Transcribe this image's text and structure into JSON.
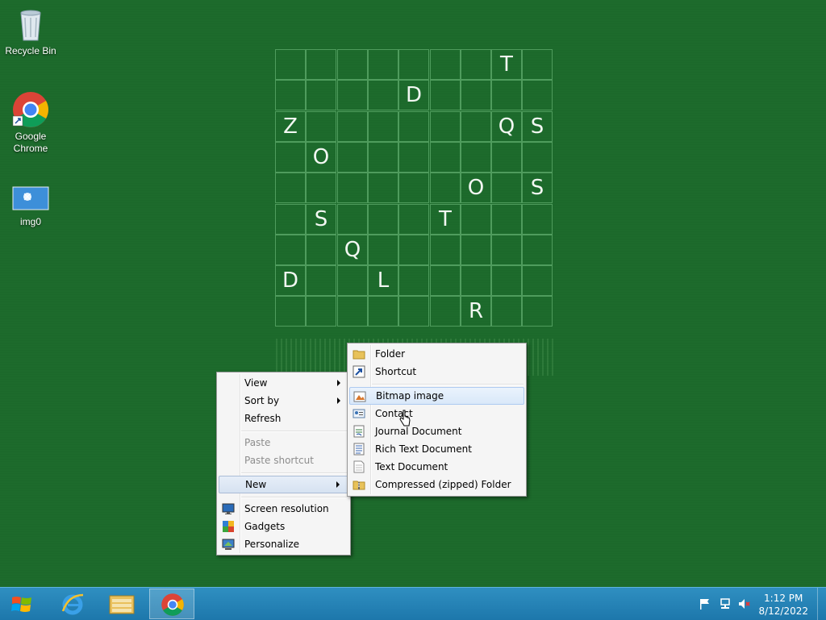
{
  "desktop": {
    "icons": [
      {
        "label": "Recycle Bin",
        "icon": "recycle-bin-icon"
      },
      {
        "label": "Google\nChrome",
        "icon": "chrome-icon"
      },
      {
        "label": "img0",
        "icon": "image-file-icon"
      }
    ]
  },
  "wallpaper": {
    "grid_rows": [
      [
        "",
        "",
        "",
        "",
        "",
        "",
        "",
        "T",
        ""
      ],
      [
        "",
        "",
        "",
        "",
        "D",
        "",
        "",
        "",
        ""
      ],
      [
        "Z",
        "",
        "",
        "",
        "",
        "",
        "",
        "Q",
        "S"
      ],
      [
        "",
        "O",
        "",
        "",
        "",
        "",
        "",
        "",
        ""
      ],
      [
        "",
        "",
        "",
        "",
        "",
        "",
        "O",
        "",
        "S"
      ],
      [
        "",
        "S",
        "",
        "",
        "",
        "T",
        "",
        "",
        ""
      ],
      [
        "",
        "",
        "Q",
        "",
        "",
        "",
        "",
        "",
        ""
      ],
      [
        "D",
        "",
        "",
        "L",
        "",
        "",
        "",
        "",
        ""
      ],
      [
        "",
        "",
        "",
        "",
        "",
        "",
        "R",
        "",
        ""
      ]
    ]
  },
  "context_menu": {
    "view": "View",
    "sort_by": "Sort by",
    "refresh": "Refresh",
    "paste": "Paste",
    "paste_shortcut": "Paste shortcut",
    "new": "New",
    "screen_resolution": "Screen resolution",
    "gadgets": "Gadgets",
    "personalize": "Personalize"
  },
  "new_submenu": {
    "folder": "Folder",
    "shortcut": "Shortcut",
    "bitmap_image": "Bitmap image",
    "contact": "Contact",
    "journal_document": "Journal Document",
    "rich_text_document": "Rich Text Document",
    "text_document": "Text Document",
    "compressed_folder": "Compressed (zipped) Folder"
  },
  "taskbar": {
    "pinned": [
      "start-orb-icon",
      "internet-explorer-icon",
      "file-explorer-icon",
      "chrome-icon"
    ],
    "tray_icons": [
      "action-center-flag-icon",
      "network-icon",
      "volume-muted-icon"
    ],
    "time": "1:12 PM",
    "date": "8/12/2022"
  },
  "colors": {
    "desktop_bg": "#1d6b2c",
    "taskbar": "#1d77ab",
    "menu_bg": "#f5f5f5",
    "highlight": "#d9e8f9"
  }
}
